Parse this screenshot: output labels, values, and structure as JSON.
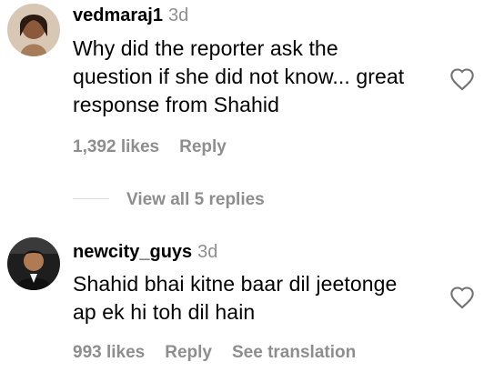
{
  "comments": [
    {
      "username": "vedmaraj1",
      "time": "3d",
      "text_lines": [
        "Why did the reporter ask the",
        "question if she did not know... great",
        "response from Shahid"
      ],
      "likes": "1,392 likes",
      "reply": "Reply",
      "view_replies": "View all 5 replies"
    },
    {
      "username": "newcity_guys",
      "time": "3d",
      "text_lines": [
        "Shahid bhai kitne baar dil jeetonge",
        "ap ek hi toh dil hain"
      ],
      "likes": "993 likes",
      "reply": "Reply",
      "see_translation": "See translation"
    }
  ],
  "icons": {
    "like": "heart-outline-icon"
  },
  "colors": {
    "text": "#000000",
    "muted": "#8e8e8e",
    "divider": "#dbdbdb"
  }
}
